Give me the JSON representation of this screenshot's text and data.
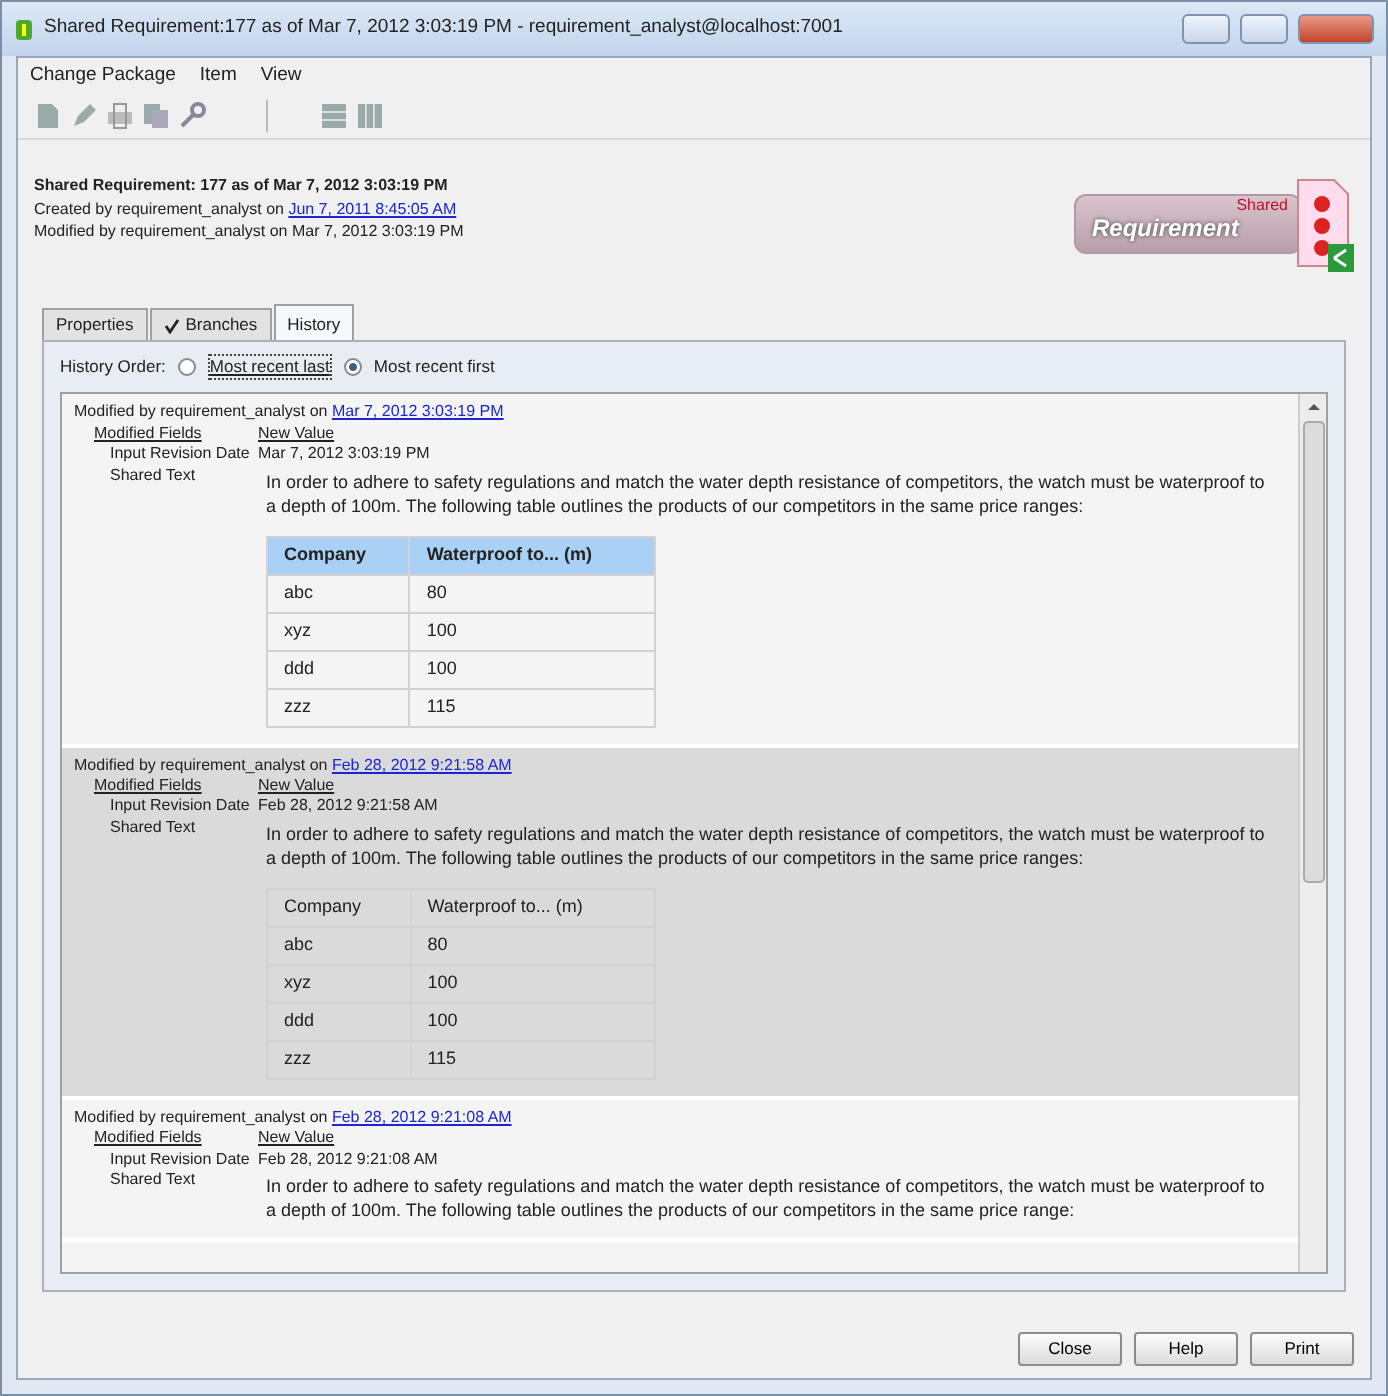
{
  "window": {
    "title": "Shared Requirement:177 as of Mar 7, 2012 3:03:19 PM - requirement_analyst@localhost:7001"
  },
  "menu": [
    "Change Package",
    "Item",
    "View"
  ],
  "header": {
    "title": "Shared Requirement: 177 as of Mar 7, 2012 3:03:19 PM",
    "created_prefix": "Created by requirement_analyst on",
    "created_link": "Jun 7, 2011 8:45:05 AM",
    "modified": "Modified by requirement_analyst on Mar 7, 2012 3:03:19 PM"
  },
  "logo": {
    "label": "Requirement",
    "badge": "Shared"
  },
  "tabs": [
    {
      "label": "Properties",
      "selected": false,
      "checked": false
    },
    {
      "label": "Branches",
      "selected": false,
      "checked": true
    },
    {
      "label": "History",
      "selected": true,
      "checked": false
    }
  ],
  "history_order": {
    "label": "History Order:",
    "options": [
      {
        "label": "Most recent last",
        "selected": false
      },
      {
        "label": "Most recent first",
        "selected": true
      }
    ]
  },
  "entries": [
    {
      "selected": false,
      "by": "Modified by requirement_analyst on",
      "date": "Mar 7, 2012 3:03:19 PM",
      "fields_heading": "Modified Fields",
      "value_heading": "New Value",
      "field_names": [
        "Input Revision Date",
        "Shared Text"
      ],
      "revision_date": "Mar 7, 2012 3:03:19 PM",
      "text": "In order to adhere to safety regulations and match the water depth resistance of competitors, the watch must be waterproof to a depth of 100m. The following table outlines the products of our competitors in the same price ranges:",
      "table": {
        "columns": [
          "Company",
          "Waterproof to... (m)"
        ],
        "rows": [
          [
            "abc",
            "80"
          ],
          [
            "xyz",
            "100"
          ],
          [
            "ddd",
            "100"
          ],
          [
            "zzz",
            "115"
          ]
        ]
      }
    },
    {
      "selected": true,
      "by": "Modified by requirement_analyst on",
      "date": "Feb 28, 2012 9:21:58 AM",
      "fields_heading": "Modified Fields",
      "value_heading": "New Value",
      "field_names": [
        "Input Revision Date",
        "Shared Text"
      ],
      "revision_date": "Feb 28, 2012 9:21:58 AM",
      "text": "In order to adhere to safety regulations and match the water depth resistance of competitors, the watch must be waterproof to a depth of 100m. The following table outlines the products of our competitors in the same price ranges:",
      "table": {
        "columns": [
          "Company",
          "Waterproof to... (m)"
        ],
        "rows": [
          [
            "abc",
            "80"
          ],
          [
            "xyz",
            "100"
          ],
          [
            "ddd",
            "100"
          ],
          [
            "zzz",
            "115"
          ]
        ]
      }
    },
    {
      "selected": false,
      "by": "Modified by requirement_analyst on",
      "date": "Feb 28, 2012 9:21:08 AM",
      "fields_heading": "Modified Fields",
      "value_heading": "New Value",
      "field_names": [
        "Input Revision Date",
        "Shared Text"
      ],
      "revision_date": "Feb 28, 2012 9:21:08 AM",
      "text": "In order to adhere to safety regulations and match the water depth resistance of competitors, the watch must be waterproof to a depth of 100m. The following table outlines the products of our competitors in the same price range:"
    }
  ],
  "buttons": [
    "Close",
    "Help",
    "Print"
  ]
}
